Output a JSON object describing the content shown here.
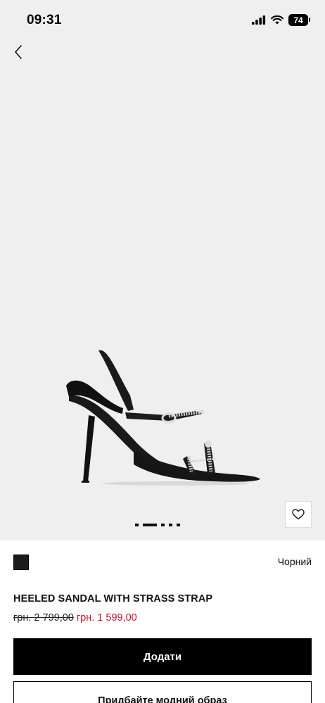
{
  "status_bar": {
    "time": "09:31",
    "battery": "74"
  },
  "product": {
    "color_name": "Чорний",
    "title": "HEELED SANDAL WITH STRASS STRAP",
    "old_price": "грн. 2 799,00",
    "new_price": "грн. 1 599,00",
    "image_icon": "black-strappy-heeled-sandal",
    "swatch_color": "#1b1b1b",
    "sale_color": "#c8102e"
  },
  "gallery": {
    "image_count": 5,
    "active_index": 1
  },
  "actions": {
    "add_label": "Додати",
    "outfit_label": "Придбайте модний образ"
  }
}
